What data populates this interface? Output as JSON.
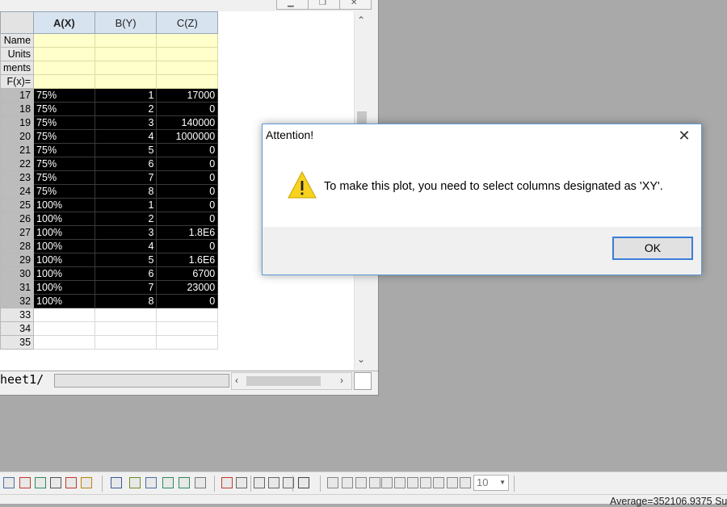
{
  "columns": {
    "a": "A(X)",
    "b": "B(Y)",
    "c": "C(Z)"
  },
  "meta_rows": [
    "Name",
    "Units",
    "ments",
    "F(x)="
  ],
  "rows": [
    {
      "n": "17",
      "a": "75%",
      "b": "1",
      "c": "17000"
    },
    {
      "n": "18",
      "a": "75%",
      "b": "2",
      "c": "0"
    },
    {
      "n": "19",
      "a": "75%",
      "b": "3",
      "c": "140000"
    },
    {
      "n": "20",
      "a": "75%",
      "b": "4",
      "c": "1000000"
    },
    {
      "n": "21",
      "a": "75%",
      "b": "5",
      "c": "0"
    },
    {
      "n": "22",
      "a": "75%",
      "b": "6",
      "c": "0"
    },
    {
      "n": "23",
      "a": "75%",
      "b": "7",
      "c": "0"
    },
    {
      "n": "24",
      "a": "75%",
      "b": "8",
      "c": "0"
    },
    {
      "n": "25",
      "a": "100%",
      "b": "1",
      "c": "0"
    },
    {
      "n": "26",
      "a": "100%",
      "b": "2",
      "c": "0"
    },
    {
      "n": "27",
      "a": "100%",
      "b": "3",
      "c": "1.8E6"
    },
    {
      "n": "28",
      "a": "100%",
      "b": "4",
      "c": "0"
    },
    {
      "n": "29",
      "a": "100%",
      "b": "5",
      "c": "1.6E6"
    },
    {
      "n": "30",
      "a": "100%",
      "b": "6",
      "c": "6700"
    },
    {
      "n": "31",
      "a": "100%",
      "b": "7",
      "c": "23000"
    },
    {
      "n": "32",
      "a": "100%",
      "b": "8",
      "c": "0"
    }
  ],
  "empty_rows": [
    "33",
    "34",
    "35"
  ],
  "sheet_tab": "heet1",
  "dialog": {
    "title": "Attention!",
    "message": "To make this plot, you need to select columns designated as 'XY'.",
    "ok_label": "OK",
    "icon": "warning-icon"
  },
  "toolbar": {
    "zoom_value": "10"
  },
  "status": {
    "text": "Average=352106.9375 Su"
  },
  "colors": {
    "selection_bg": "#000000",
    "meta_bg": "#ffffcc",
    "header_bg": "#d8e3f0",
    "accent": "#3b7dd8",
    "warning": "#f7d21e"
  }
}
